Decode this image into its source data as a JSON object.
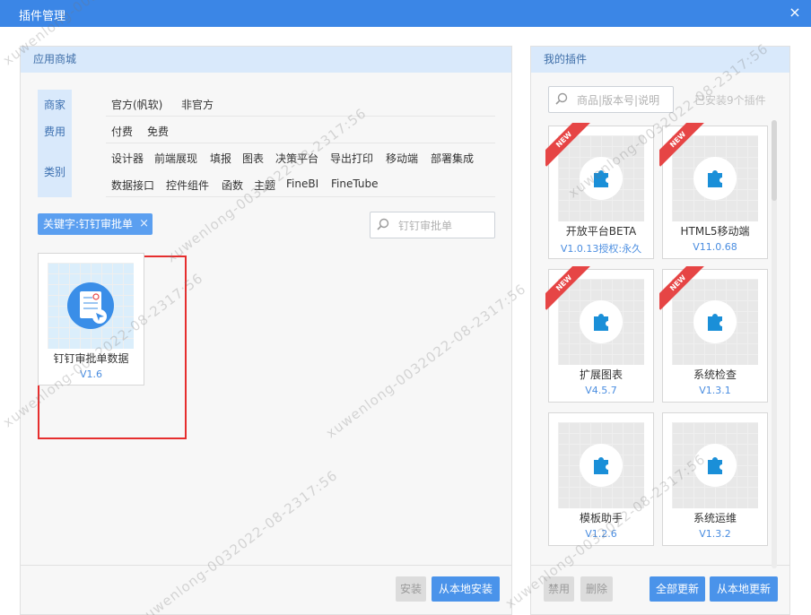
{
  "window": {
    "title": "插件管理",
    "close_glyph": "×"
  },
  "store": {
    "title": "应用商城",
    "filter_labels": [
      "商家",
      "费用",
      "类别"
    ],
    "vendor_options": [
      "官方(帆软)",
      "非官方"
    ],
    "fee_options": [
      "付费",
      "免费"
    ],
    "category_options_row1": [
      "设计器",
      "前端展现",
      "填报",
      "图表",
      "决策平台",
      "导出打印",
      "移动端",
      "部署集成"
    ],
    "category_options_row2": [
      "数据接口",
      "控件组件",
      "函数",
      "主题",
      "FineBI",
      "FineTube"
    ],
    "keyword_tag": "关键字:钉钉审批单",
    "keyword_tag_close": "×",
    "search_placeholder": "钉钉审批单",
    "results": [
      {
        "name": "钉钉审批单数据",
        "version": "V1.6"
      }
    ],
    "install_label": "安装",
    "local_install_label": "从本地安装"
  },
  "mine": {
    "title": "我的插件",
    "search_placeholder": "商品|版本号|说明",
    "installed_count": "已安装9个插件",
    "new_badge": "NEW",
    "plugins": [
      {
        "name": "开放平台BETA",
        "version": "V1.0.13授权:永久",
        "is_new": true
      },
      {
        "name": "HTML5移动端",
        "version": "V11.0.68",
        "is_new": true
      },
      {
        "name": "扩展图表",
        "version": "V4.5.7",
        "is_new": true
      },
      {
        "name": "系统检查",
        "version": "V1.3.1",
        "is_new": true
      },
      {
        "name": "模板助手",
        "version": "V1.2.6",
        "is_new": false
      },
      {
        "name": "系统运维",
        "version": "V1.3.2",
        "is_new": false
      }
    ],
    "disable_label": "禁用",
    "delete_label": "删除",
    "update_all_label": "全部更新",
    "local_update_label": "从本地更新"
  },
  "watermark_text": "xuwenlong-0032022-08-2317:56",
  "colors": {
    "titlebar": "#3b86e6",
    "header": "#d9e9fb",
    "accent": "#4a93ea",
    "highlight": "#e62e2e",
    "badge": "#e64545"
  }
}
